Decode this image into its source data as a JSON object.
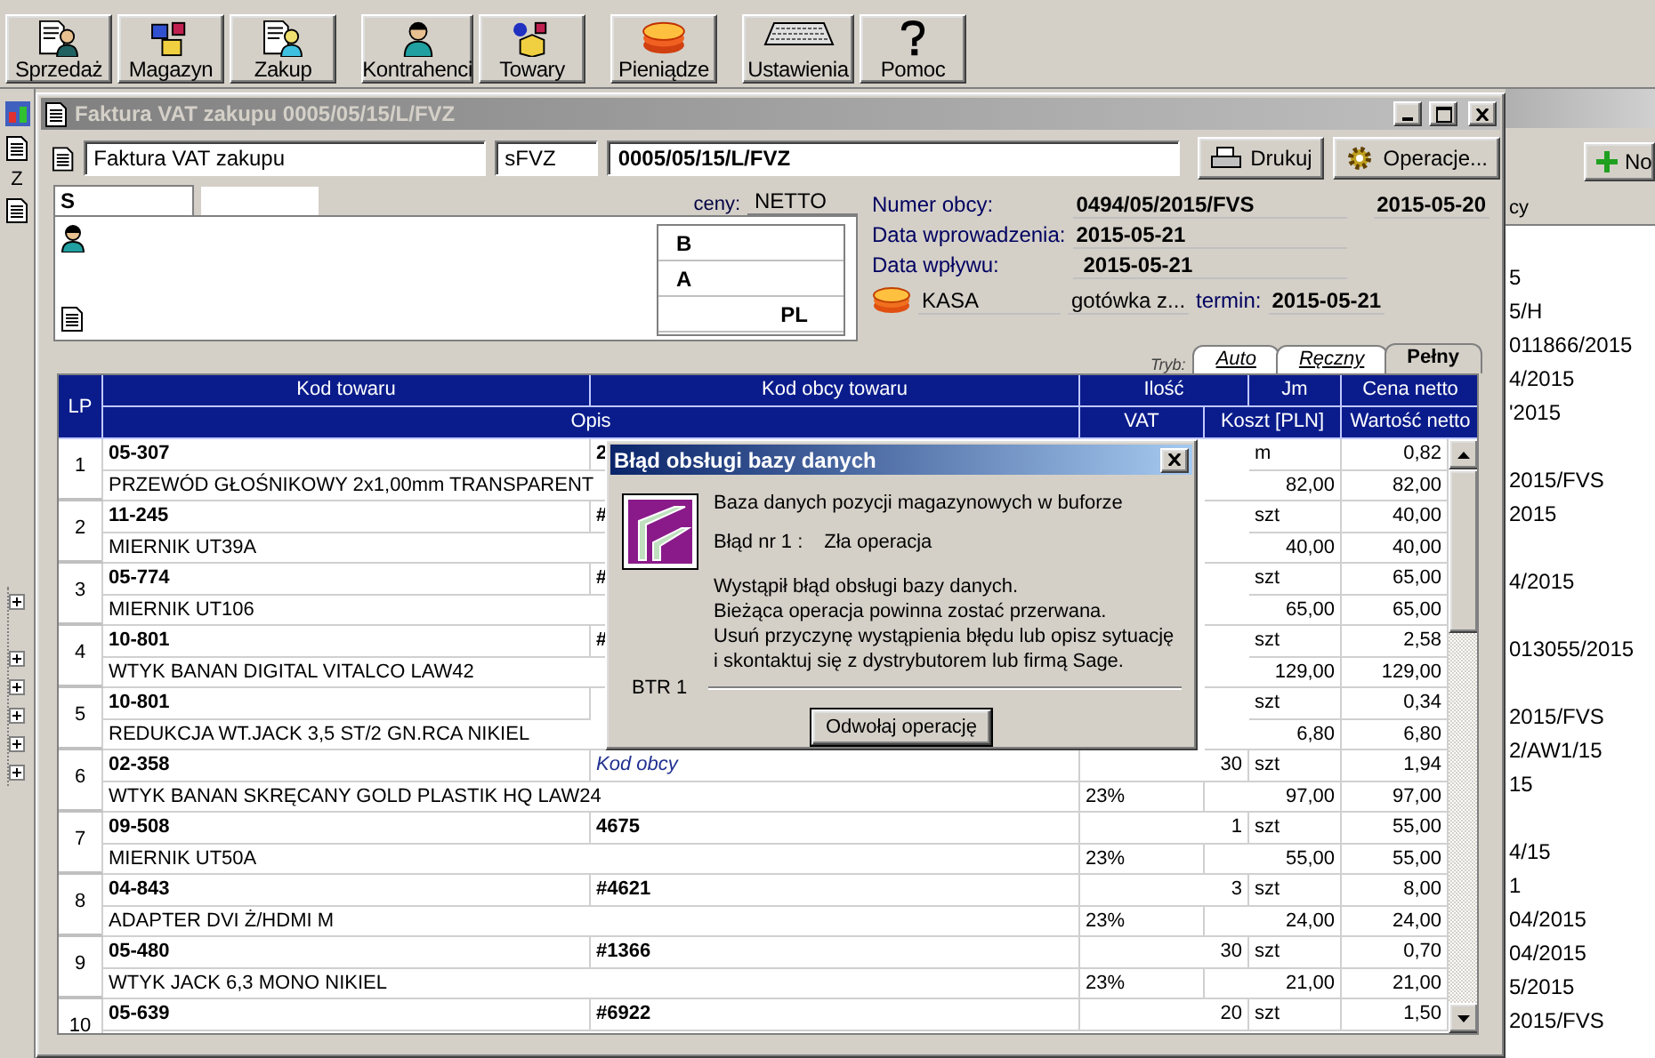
{
  "toolbar": [
    [
      {
        "label": "Sprzedaż"
      },
      {
        "label": "Magazyn"
      },
      {
        "label": "Zakup"
      }
    ],
    [
      {
        "label": "Kontrahenci"
      },
      {
        "label": "Towary"
      }
    ],
    [
      {
        "label": "Pieniądze"
      }
    ],
    [
      {
        "label": "Ustawienia"
      },
      {
        "label": "Pomoc"
      }
    ]
  ],
  "background_window": {
    "left_label": "Z",
    "new_button": "No",
    "column_header": "cy",
    "list_groups": [
      [
        "5",
        "5/H",
        "011866/2015",
        "4/2015",
        "'2015"
      ],
      [
        "2015/FVS",
        "2015"
      ],
      [
        "4/2015"
      ],
      [
        "013055/2015"
      ],
      [
        "2015/FVS",
        "2/AW1/15",
        "15"
      ],
      [
        "4/15",
        "1",
        "04/2015",
        "04/2015",
        "5/2015",
        "2015/FVS"
      ]
    ]
  },
  "main_window": {
    "title": "Faktura VAT zakupu 0005/05/15/L/FVZ",
    "active": false,
    "document_type": "Faktura VAT zakupu",
    "series": "sFVZ",
    "number": "0005/05/15/L/FVZ",
    "buttons": [
      "Drukuj",
      "Operacje..."
    ],
    "contractor": {
      "tab": "S",
      "price_label": "ceny:",
      "price_type": "NETTO",
      "lines": [
        "B",
        "A",
        "PL"
      ]
    },
    "details": {
      "foreign_number_label": "Numer obcy:",
      "foreign_number": "0494/05/2015/FVS",
      "foreign_date": "2015-05-20",
      "entry_date_label": "Data wprowadzenia:",
      "entry_date": "2015-05-21",
      "receipt_date_label": "Data wpływu:",
      "receipt_date": "2015-05-21",
      "cash_register": "KASA",
      "payment": "gotówka z...",
      "due_label": "termin:",
      "due_date": "2015-05-21"
    },
    "mode": {
      "label": "Tryb:",
      "tabs": [
        {
          "label": "Auto",
          "selected": false
        },
        {
          "label": "Ręczny",
          "selected": false
        },
        {
          "label": "Pełny",
          "selected": true
        }
      ]
    },
    "table": {
      "header_top": [
        "LP",
        "Kod towaru",
        "Kod obcy towaru",
        "Ilość",
        "Jm",
        "Cena netto"
      ],
      "header_bottom": [
        "Opis",
        "VAT",
        "Koszt [PLN]",
        "Wartość netto"
      ],
      "rows": [
        {
          "lp": "1",
          "code": "05-307",
          "foreign_code": {
            "value": "2"
          },
          "unit": "m",
          "price": "0,82",
          "description": "PRZEWÓD GŁOŚNIKOWY 2x1,00mm TRANSPARENT",
          "cost": "82,00",
          "net_value": "82,00"
        },
        {
          "lp": "2",
          "code": "11-245",
          "foreign_code": {
            "value": "#"
          },
          "unit": "szt",
          "price": "40,00",
          "description": "MIERNIK UT39A",
          "cost": "40,00",
          "net_value": "40,00"
        },
        {
          "lp": "3",
          "code": "05-774",
          "foreign_code": {
            "value": "#"
          },
          "unit": "szt",
          "price": "65,00",
          "description": "MIERNIK UT106",
          "cost": "65,00",
          "net_value": "65,00"
        },
        {
          "lp": "4",
          "code": "10-801",
          "foreign_code": {
            "value": "#"
          },
          "unit": "szt",
          "price": "2,58",
          "description": "WTYK BANAN DIGITAL VITALCO LAW42",
          "cost": "129,00",
          "net_value": "129,00"
        },
        {
          "lp": "5",
          "code": "10-801",
          "unit": "szt",
          "price": "0,34",
          "description": "REDUKCJA WT.JACK 3,5 ST/2 GN.RCA NIKIEL",
          "cost": "6,80",
          "net_value": "6,80"
        },
        {
          "lp": "6",
          "code": "02-358",
          "foreign_code": {
            "placeholder": "Kod obcy"
          },
          "quantity": "30",
          "unit": "szt",
          "price": "1,94",
          "description": "WTYK BANAN SKRĘCANY GOLD PLASTIK HQ LAW24",
          "vat": "23%",
          "cost": "97,00",
          "net_value": "97,00"
        },
        {
          "lp": "7",
          "code": "09-508",
          "foreign_code": {
            "value": "4675"
          },
          "quantity": "1",
          "unit": "szt",
          "price": "55,00",
          "description": "MIERNIK UT50A",
          "vat": "23%",
          "cost": "55,00",
          "net_value": "55,00"
        },
        {
          "lp": "8",
          "code": "04-843",
          "foreign_code": {
            "value": "#4621"
          },
          "quantity": "3",
          "unit": "szt",
          "price": "8,00",
          "description": "ADAPTER DVI Ż/HDMI M",
          "vat": "23%",
          "cost": "24,00",
          "net_value": "24,00"
        },
        {
          "lp": "9",
          "code": "05-480",
          "foreign_code": {
            "value": "#1366"
          },
          "quantity": "30",
          "unit": "szt",
          "price": "0,70",
          "description": "WTYK JACK 6,3 MONO NIKIEL",
          "vat": "23%",
          "cost": "21,00",
          "net_value": "21,00"
        },
        {
          "lp": "10",
          "code": "05-639",
          "foreign_code": {
            "value": "#6922"
          },
          "quantity": "20",
          "unit": "szt",
          "price": "1,50"
        }
      ]
    }
  },
  "dialog": {
    "title": "Błąd obsługi bazy danych",
    "active": true,
    "heading": "Baza danych pozycji magazynowych w buforze",
    "error_label": "Błąd nr 1 :",
    "error_text": "Zła operacja",
    "message": [
      "Wystąpił błąd obsługi bazy danych.",
      "Bieżąca operacja powinna zostać przerwana.",
      "Usuń przyczynę wystąpienia błędu lub opisz sytuację",
      "i skontaktuj się z dystrybutorem lub firmą Sage."
    ],
    "code": "BTR 1",
    "button": "Odwołaj operację"
  }
}
